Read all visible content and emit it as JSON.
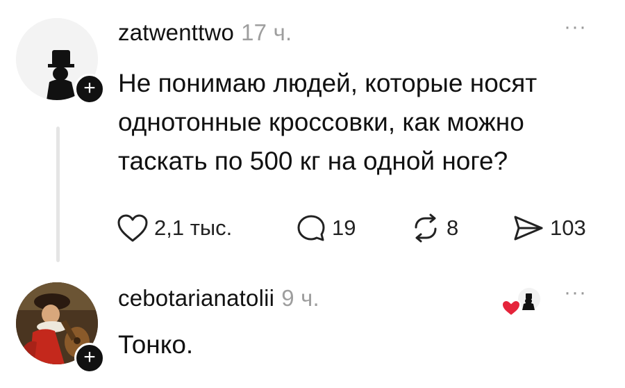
{
  "posts": [
    {
      "username": "zatwenttwo",
      "time": "17 ч.",
      "text": "Не понимаю людей, которые носят однотонные кроссовки, как можно таскать по 500 кг на одной ноге?",
      "more": "···",
      "follow": "+",
      "actions": {
        "likes": "2,1 тыс.",
        "replies": "19",
        "reposts": "8",
        "shares": "103"
      }
    },
    {
      "username": "cebotarianatolii",
      "time": "9 ч.",
      "text": "Тонко.",
      "more": "···",
      "follow": "+"
    }
  ],
  "colors": {
    "text": "#111111",
    "muted": "#9e9e9e",
    "thread": "#e5e5e5",
    "heart": "#e5243b"
  },
  "icons": {
    "like": "heart-icon",
    "reply": "speech-bubble-icon",
    "repost": "repost-arrows-icon",
    "share": "paper-plane-icon",
    "more": "more-dots-icon",
    "follow": "plus-icon"
  }
}
